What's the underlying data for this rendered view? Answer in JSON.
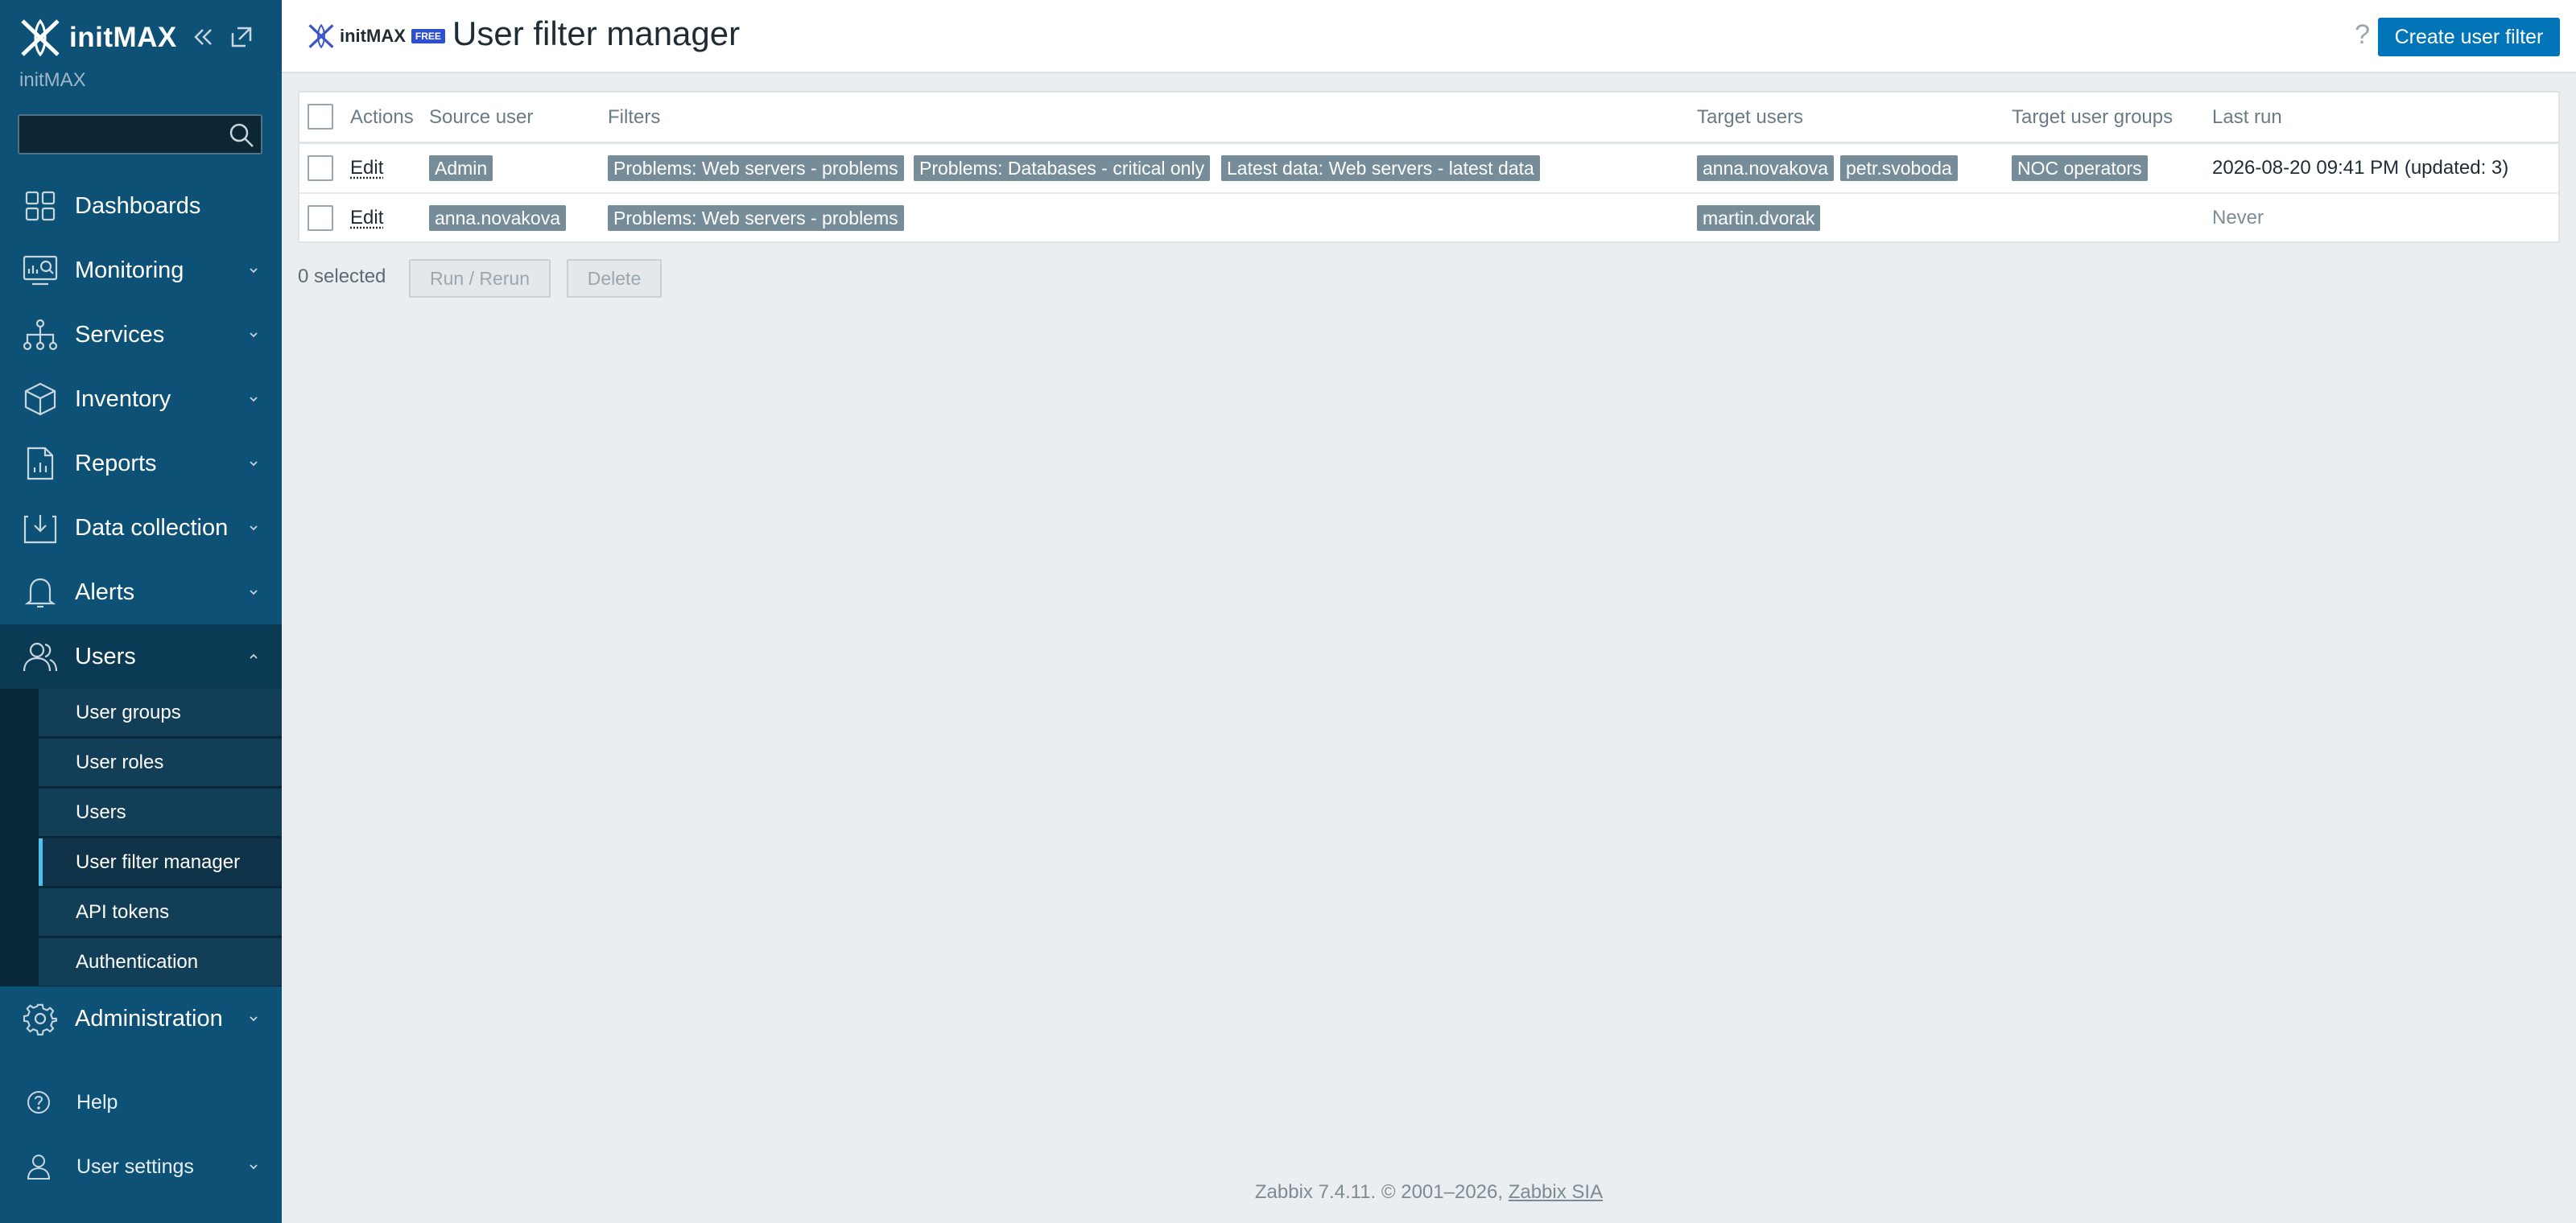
{
  "brand": {
    "name": "initMAX",
    "server_name": "initMAX"
  },
  "search": {
    "placeholder": ""
  },
  "nav": {
    "dashboards": "Dashboards",
    "monitoring": "Monitoring",
    "services": "Services",
    "inventory": "Inventory",
    "reports": "Reports",
    "data_collection": "Data collection",
    "alerts": "Alerts",
    "users": "Users",
    "administration": "Administration",
    "help": "Help",
    "user_settings": "User settings"
  },
  "users_submenu": [
    "User groups",
    "User roles",
    "Users",
    "User filter manager",
    "API tokens",
    "Authentication"
  ],
  "header": {
    "logo_text": "initMAX",
    "badge": "FREE",
    "title": "User filter manager",
    "help": "?",
    "create_button": "Create user filter"
  },
  "table": {
    "columns": [
      "Actions",
      "Source user",
      "Filters",
      "Target users",
      "Target user groups",
      "Last run"
    ],
    "rows": [
      {
        "action": "Edit",
        "source_user": "Admin",
        "filters": [
          "Problems: Web servers - problems",
          "Problems: Databases - critical only",
          "Latest data: Web servers - latest data"
        ],
        "target_users": [
          "anna.novakova",
          "petr.svoboda"
        ],
        "target_user_groups": [
          "NOC operators"
        ],
        "last_run": "2026-08-20 09:41 PM (updated: 3)"
      },
      {
        "action": "Edit",
        "source_user": "anna.novakova",
        "filters": [
          "Problems: Web servers - problems"
        ],
        "target_users": [
          "martin.dvorak"
        ],
        "target_user_groups": [],
        "last_run": "Never"
      }
    ]
  },
  "actions": {
    "selected": "0 selected",
    "run": "Run / Rerun",
    "delete": "Delete"
  },
  "footer": {
    "text": "Zabbix 7.4.11. © 2001–2026, ",
    "link": "Zabbix SIA"
  },
  "colors": {
    "sidebar": "#0e5176",
    "accent": "#0275b8",
    "tag": "#768d99",
    "submenu_marker": "#4cc1ee"
  }
}
